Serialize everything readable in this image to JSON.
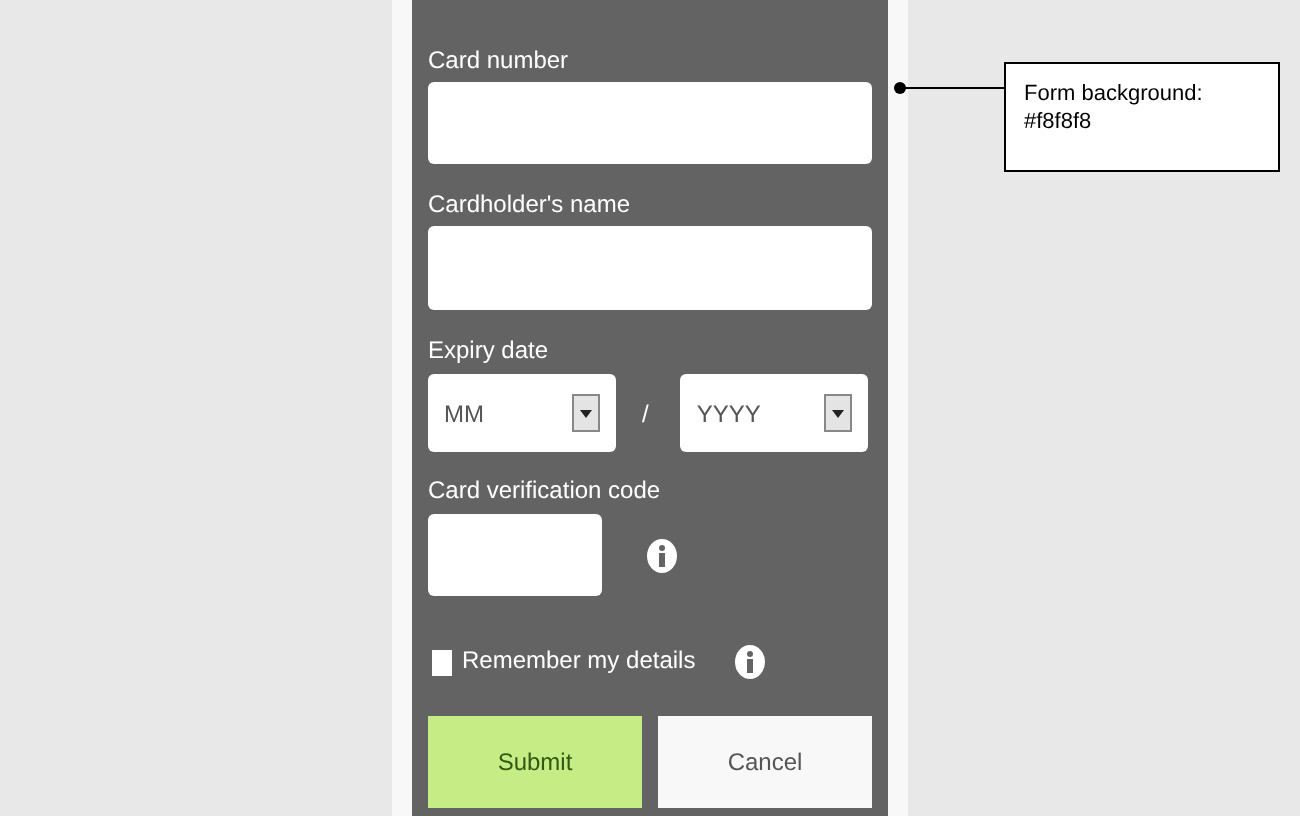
{
  "form": {
    "card_number": {
      "label": "Card number"
    },
    "cardholder_name": {
      "label": "Cardholder's name"
    },
    "expiry": {
      "label": "Expiry date",
      "month_placeholder": "MM",
      "separator": "/",
      "year_placeholder": "YYYY"
    },
    "cvc": {
      "label": "Card verification code"
    },
    "remember": {
      "label": "Remember my details",
      "checked": false
    },
    "buttons": [
      {
        "label": "Submit",
        "kind": "primary"
      },
      {
        "label": "Cancel",
        "kind": "secondary"
      }
    ]
  },
  "annotation": {
    "lines": [
      "Form background:",
      "#f8f8f8"
    ]
  }
}
